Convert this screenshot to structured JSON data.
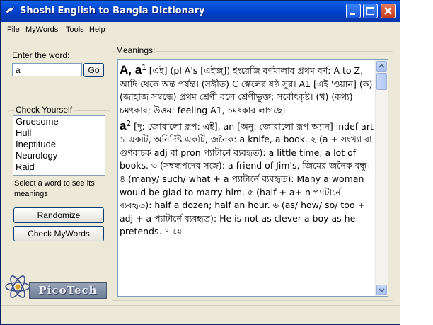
{
  "window": {
    "title": "Shoshi English to Bangla Dictionary",
    "buttons": [
      "minimize",
      "maximize",
      "close"
    ]
  },
  "menu": [
    "File",
    "MyWords",
    "Tools",
    "Help"
  ],
  "search": {
    "label": "Enter the word:",
    "value": "a",
    "go_label": "Go"
  },
  "check_yourself": {
    "legend": "Check Yourself",
    "items": [
      "Gruesome",
      "Hull",
      "Ineptitude",
      "Neurology",
      "Raid"
    ],
    "hint": "Select a word to see its meanings",
    "randomize_label": "Randomize",
    "check_mywords_label": "Check MyWords"
  },
  "logo": {
    "text": "PicoTech"
  },
  "meanings": {
    "legend": "Meanings:",
    "entry1_head": "A, a",
    "entry1_sup": "1",
    "entry1_body": " [এই] (pl A's [এইজ্]) ইংরেজি বর্ণমালার প্রথম বর্ণ: A to Z, আদি থেকে অন্ত পর্যন্ত। (সঙ্গীত) C স্কেলের ষষ্ঠ সুর। A1 [এই 'ওয়ান] (ক) (জাহাজ সম্বন্ধে) প্রথম শ্রেণী বলে শ্রেণীভুক্ত; সর্বোৎকৃষ্ট। (খ) (কথ্য) চমৎকার; উত্তম: feeling A1, চমৎকার লাগছে।",
    "entry2_head": "a",
    "entry2_sup": "2",
    "entry2_body": " [দু: জোরালো রূপ: এই], an [অনু: জোরালো রূপ অ্যান] indef art ১ একটি, অনির্দিষ্ট একটি, জনৈক: a knife, a book. ২ (a + সংখ্যা বা গুণবাচক adj বা pron প্যাটার্নে ব্যবহৃত): a little time; a lot of books. ৩ (সম্বন্ধপদের সঙ্গে): a friend of Jim's, জিমের জনৈক বন্ধু। ৪ (many/ such/ what + a প্যাটার্নে ব্যবহৃত): Many a woman would be glad to marry him. ৫ (half + a+ n প্যাটার্নে ব্যবহৃত): half a dozen; half an hour. ৬ (as/ how/ so/ too + adj + a প্যাটার্নে ব্যবহৃত): He is not as clever a boy as he pretends. ৭ যে"
  },
  "colors": {
    "titlebar": "#0a5fe6",
    "window_bg": "#ece9d8",
    "input_border": "#7f9db9"
  }
}
